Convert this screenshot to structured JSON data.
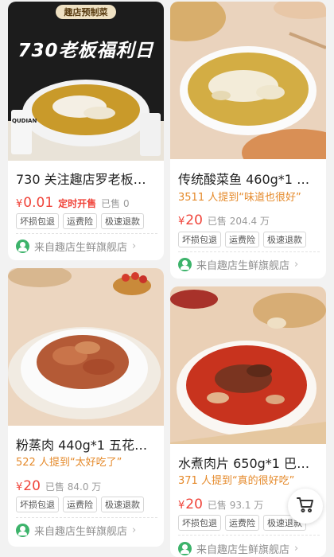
{
  "products": [
    {
      "title": "730 关注趣店罗老板浮…",
      "badge": "趣店预制菜",
      "banner_text": "730老板福利日",
      "pack_label": "QUDIAN",
      "price_symbol": "¥",
      "price": "0.01",
      "sale_tag": "定时开售",
      "sold": "已售 0",
      "tags": [
        "坏损包退",
        "运费险",
        "极速退款"
      ],
      "shop": "来自趣店生鲜旗舰店"
    },
    {
      "title": "传统酸菜鱼 460g*1 鱼…",
      "mention": "3511 人提到“味道也很好”",
      "price_symbol": "¥",
      "price": "20",
      "sold": "已售 204.4 万",
      "tags": [
        "坏损包退",
        "运费险",
        "极速退款"
      ],
      "shop": "来自趣店生鲜旗舰店"
    },
    {
      "title": "粉蒸肉 440g*1 五花肉…",
      "mention": "522 人提到“太好吃了”",
      "price_symbol": "¥",
      "price": "20",
      "sold": "已售 84.0 万",
      "tags": [
        "坏损包退",
        "运费险",
        "极速退款"
      ],
      "shop": "来自趣店生鲜旗舰店"
    },
    {
      "title": "水煮肉片 650g*1 巴渝…",
      "mention": "371 人提到“真的很好吃”",
      "price_symbol": "¥",
      "price": "20",
      "sold": "已售 93.1 万",
      "tags": [
        "坏损包退",
        "运费险",
        "极速退款"
      ],
      "shop": "来自趣店生鲜旗舰店"
    }
  ],
  "colors": {
    "price": "#f0443a",
    "mention": "#e58a2b",
    "shop_logo": "#3db36b"
  },
  "icons": {
    "shop": "shop-logo-icon",
    "chevron": "chevron-right-icon",
    "cart": "cart-icon"
  }
}
